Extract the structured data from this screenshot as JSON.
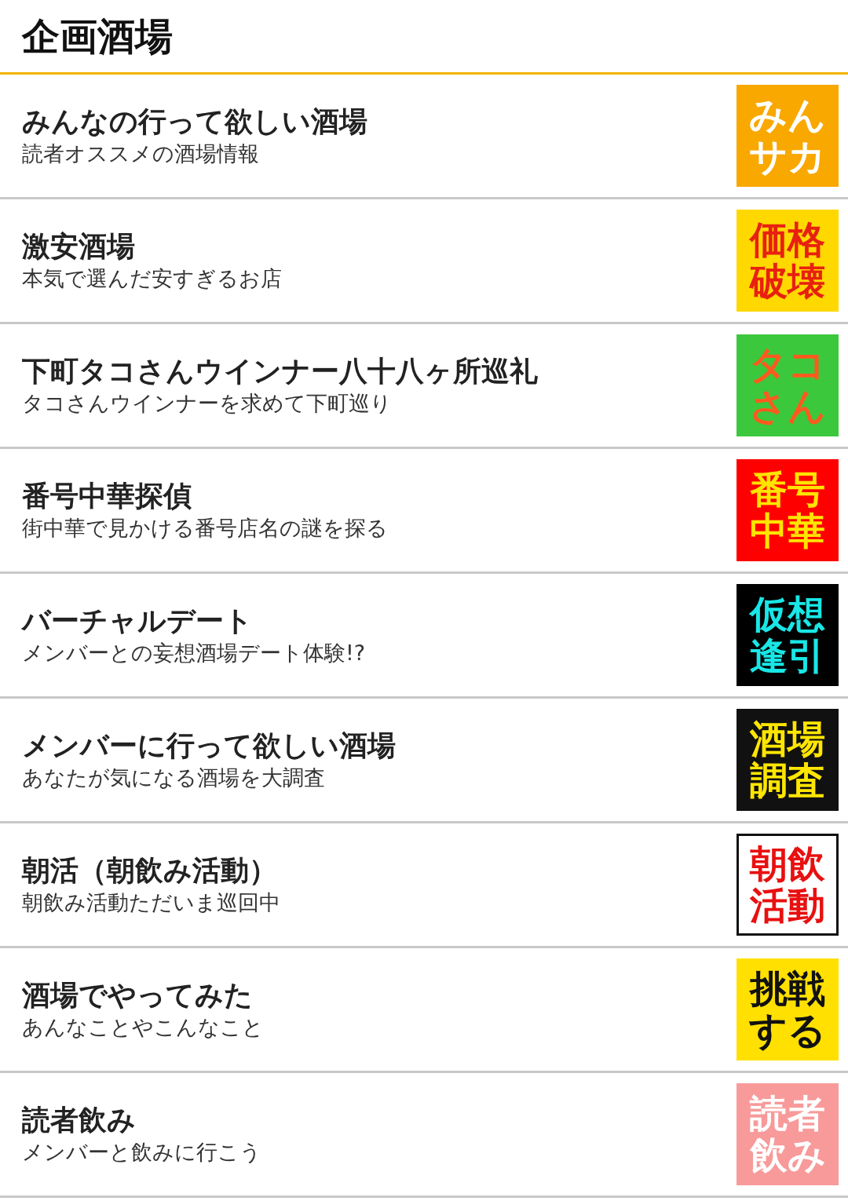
{
  "header": {
    "title": "企画酒場"
  },
  "items": [
    {
      "title": "みんなの行って欲しい酒場",
      "subtitle": "読者オススメの酒場情報",
      "badge": {
        "color": "#f9a800",
        "label": {
          "lines": [
            "みん",
            "サカ"
          ],
          "color": "#ffffff"
        }
      }
    },
    {
      "title": "激安酒場",
      "subtitle": "本気で選んだ安すぎるお店",
      "badge": {
        "color": "#ffd800",
        "label": {
          "lines": [
            "価格",
            "破壊"
          ],
          "color": "#e82010"
        }
      }
    },
    {
      "title": "下町タコさんウインナー八十八ヶ所巡礼",
      "subtitle": "タコさんウインナーを求めて下町巡り",
      "badge": {
        "color": "#3cc83c",
        "label": {
          "lines": [
            "タコ",
            "さん"
          ],
          "color": "#ff5a1e"
        }
      }
    },
    {
      "title": "番号中華探偵",
      "subtitle": "街中華で見かける番号店名の謎を探る",
      "badge": {
        "color": "#ff0000",
        "label": {
          "lines": [
            "番号",
            "中華"
          ],
          "color": "#ffe400"
        }
      }
    },
    {
      "title": "バーチャルデート",
      "subtitle": "メンバーとの妄想酒場デート体験!?",
      "badge": {
        "color": "#000000",
        "label": {
          "lines": [
            "仮想",
            "逢引"
          ],
          "color": "#19e6e6"
        }
      }
    },
    {
      "title": "メンバーに行って欲しい酒場",
      "subtitle": "あなたが気になる酒場を大調査",
      "badge": {
        "color": "#111111",
        "label": {
          "lines": [
            "酒場",
            "調査"
          ],
          "color": "#ffe600"
        }
      }
    },
    {
      "title": "朝活（朝飲み活動）",
      "subtitle": "朝飲み活動ただいま巡回中",
      "badge": {
        "color": "#ffffff",
        "label": {
          "lines": [
            "朝飲",
            "活動"
          ],
          "color": "#e81010"
        },
        "frame": {
          "color": "#111111"
        }
      }
    },
    {
      "title": "酒場でやってみた",
      "subtitle": "あんなことやこんなこと",
      "badge": {
        "color": "#ffe000",
        "label": {
          "lines": [
            "挑戦",
            "する"
          ],
          "color": "#111111"
        }
      }
    },
    {
      "title": "読者飲み",
      "subtitle": "メンバーと飲みに行こう",
      "badge": {
        "color": "#f89a9a",
        "label": {
          "lines": [
            "読者",
            "飲み"
          ],
          "color": "#ffffff"
        }
      }
    }
  ]
}
